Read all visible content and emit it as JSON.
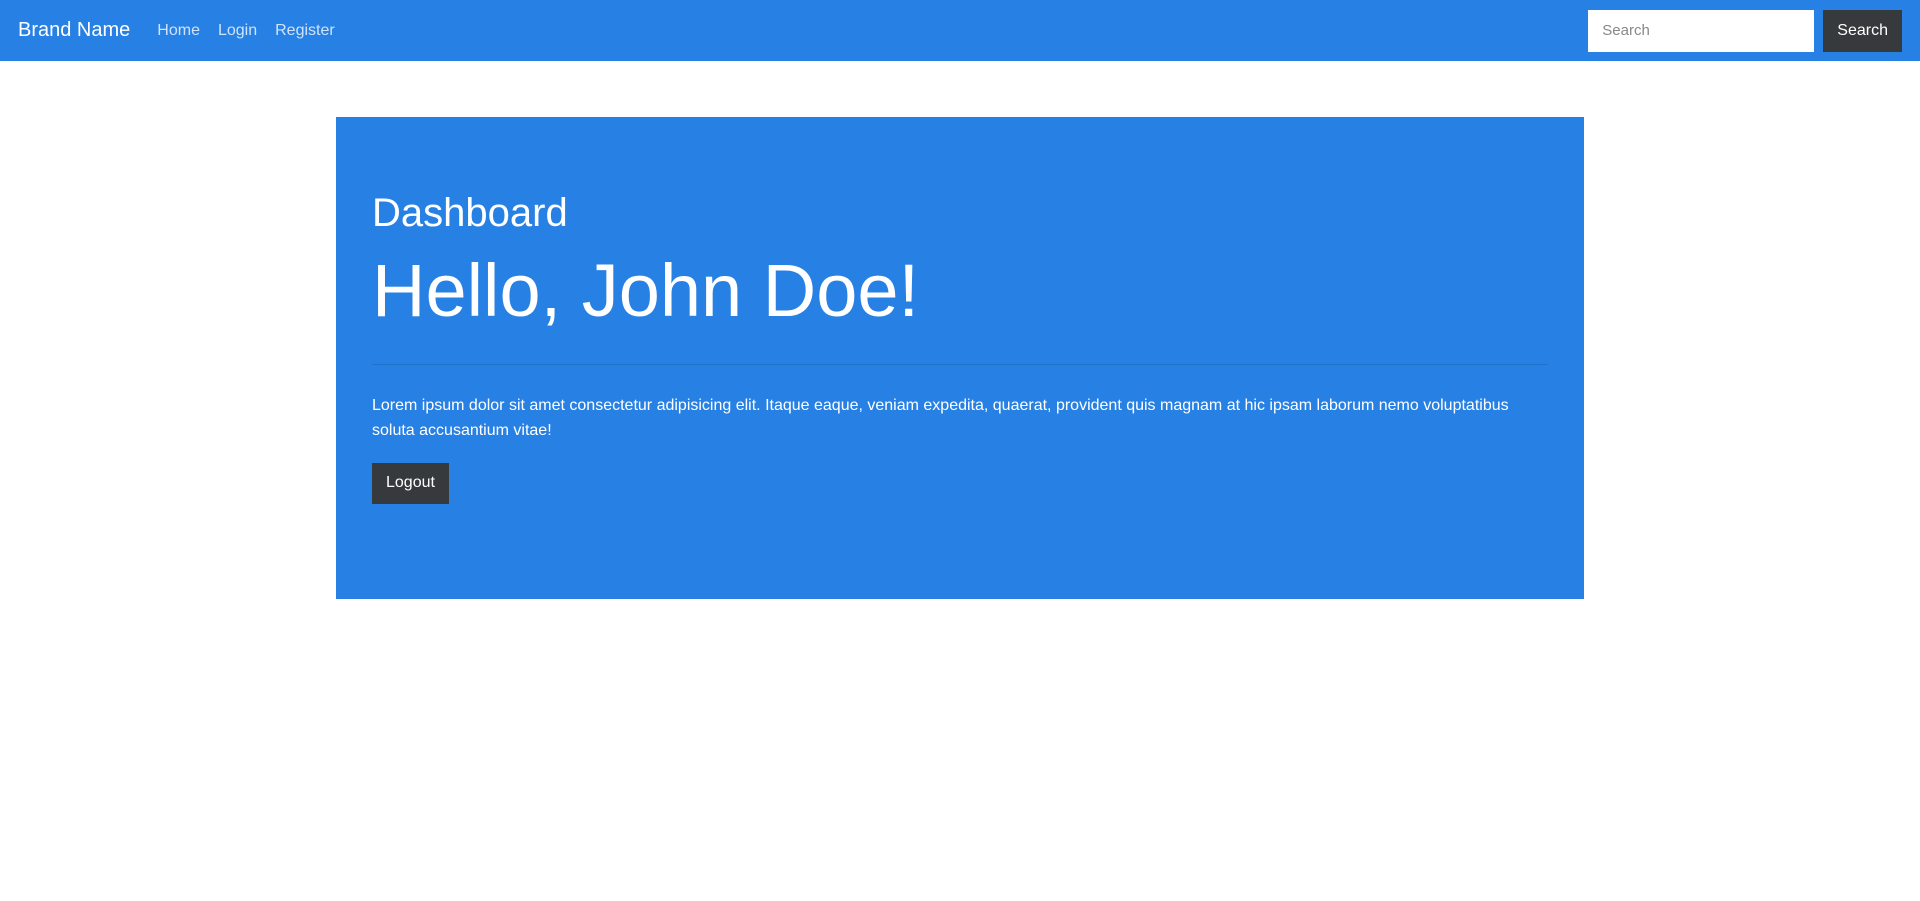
{
  "navbar": {
    "brand": "Brand Name",
    "links": [
      {
        "label": "Home"
      },
      {
        "label": "Login"
      },
      {
        "label": "Register"
      }
    ],
    "search": {
      "placeholder": "Search",
      "value": "",
      "button_label": "Search"
    }
  },
  "main": {
    "section_label": "Dashboard",
    "greeting": "Hello, John Doe!",
    "body_text": "Lorem ipsum dolor sit amet consectetur adipisicing elit. Itaque eaque, veniam expedita, quaerat, provident quis magnam at hic ipsam laborum nemo voluptatibus soluta accusantium vitae!",
    "logout_label": "Logout"
  },
  "colors": {
    "primary": "#2780e3",
    "dark": "#373a3c"
  }
}
